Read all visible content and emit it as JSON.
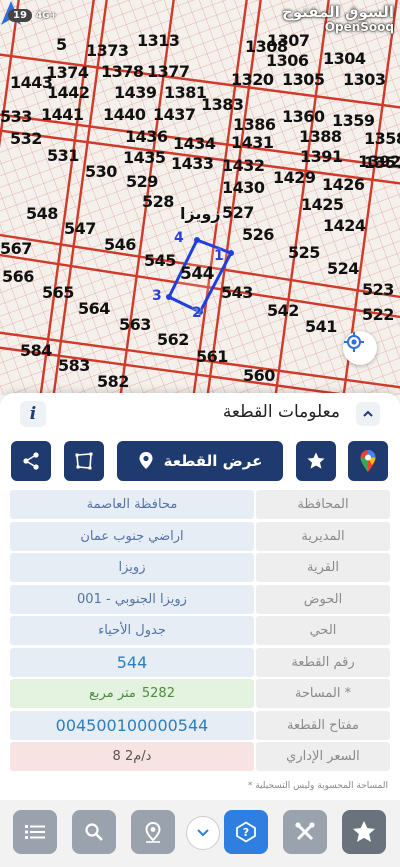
{
  "status_bar": {
    "battery": "19",
    "network": "4G+"
  },
  "watermark": {
    "arabic": "السوق المفتوح",
    "english": "OpenSooq"
  },
  "map": {
    "district_label": "زويزا",
    "plots": [
      "1313",
      "1308",
      "1307",
      "5",
      "1373",
      "1377",
      "1378",
      "1306",
      "1304",
      "1443",
      "1374",
      "1320",
      "1305",
      "1303",
      "1442",
      "1439",
      "1381",
      "1383",
      "1360",
      "1359",
      "533",
      "1441",
      "1440",
      "1437",
      "1386",
      "1358",
      "532",
      "1436",
      "1434",
      "1431",
      "1388",
      "1357",
      "531",
      "1435",
      "1433",
      "1432",
      "1391",
      "1392",
      "530",
      "529",
      "1430",
      "1429",
      "1426",
      "528",
      "527",
      "1425",
      "548",
      "547",
      "526",
      "1424",
      "567",
      "546",
      "545",
      "544",
      "525",
      "524",
      "566",
      "565",
      "543",
      "523",
      "564",
      "563",
      "542",
      "541",
      "522",
      "562",
      "584",
      "561",
      "583",
      "560",
      "582"
    ],
    "selected_plot": "544",
    "vertices": [
      "1",
      "2",
      "3",
      "4"
    ]
  },
  "sheet": {
    "title": "معلومات القطعة",
    "show_plot_button": "عرض القطعة",
    "rows": [
      {
        "label": "المحافظة",
        "value": "محافظة العاصمة"
      },
      {
        "label": "المديرية",
        "value": "اراضي جنوب عمان"
      },
      {
        "label": "القرية",
        "value": "زويزا"
      },
      {
        "label": "الحوض",
        "value": "زويزا الجنوبي - 001"
      },
      {
        "label": "الحي",
        "value": "جدول الأحياء"
      },
      {
        "label": "رقم القطعة",
        "value": "544"
      },
      {
        "label": "المساحة *",
        "value_number": "5282",
        "value_unit": "متر مربع"
      },
      {
        "label": "مفتاح القطعة",
        "value": "004500100000544"
      },
      {
        "label": "السعر الإداري",
        "value": "8 د/م2"
      }
    ],
    "footnote": "* المساحة المحسوبة وليس التسجيلية"
  },
  "colors": {
    "accent": "#1e3a6e",
    "road": "#d03a2a",
    "selected_outline": "#1f3fe0",
    "nav_active": "#2f7fe0"
  },
  "icons": [
    "share-icon",
    "map-outline-icon",
    "location-pin-icon",
    "star-icon",
    "google-maps-icon",
    "info-icon",
    "chevron-up-icon",
    "my-location-icon",
    "compass-icon",
    "list-icon",
    "search-icon",
    "pin-search-icon",
    "chevron-down-icon",
    "help-icon",
    "tools-icon",
    "star-nav-icon"
  ]
}
